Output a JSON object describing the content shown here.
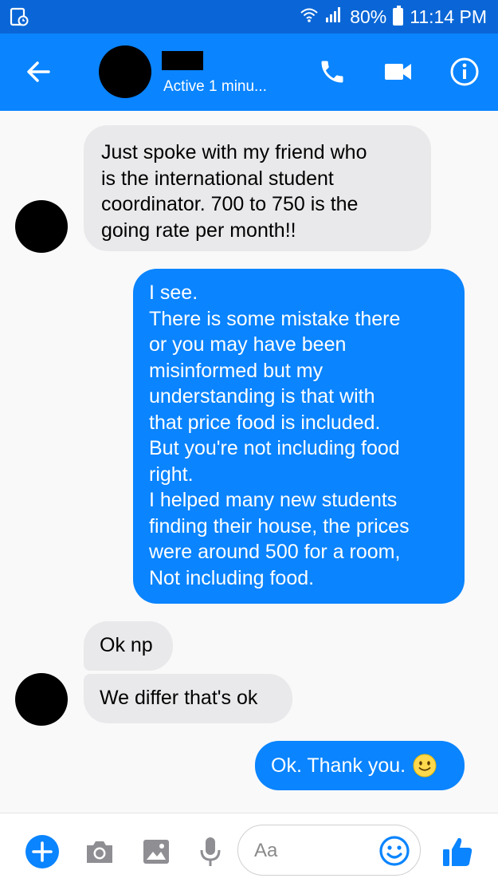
{
  "status_bar": {
    "battery": "80%",
    "time": "11:14 PM"
  },
  "header": {
    "active_status": "Active 1 minu..."
  },
  "messages": [
    {
      "direction": "incoming",
      "lines": [
        "Just spoke with my friend who",
        "is the international student",
        "coordinator. 700 to 750 is the",
        "going rate per month!!"
      ]
    },
    {
      "direction": "outgoing",
      "lines": [
        "I see.",
        "There is some mistake there",
        "or you may have been",
        "misinformed but my",
        "understanding is that with",
        "that price food is included.",
        "But you're not including food",
        "right.",
        "I helped many new students",
        "finding their house, the prices",
        "were around 500 for a room,",
        "Not including food."
      ]
    },
    {
      "direction": "incoming",
      "lines": [
        "Ok np"
      ]
    },
    {
      "direction": "incoming",
      "lines": [
        "We differ that's ok"
      ]
    },
    {
      "direction": "outgoing",
      "lines": [
        "Ok. Thank you."
      ],
      "emoji": "slightly-smiling-face"
    }
  ],
  "composer": {
    "placeholder": "Aa"
  },
  "colors": {
    "status_bar": "#0a66d6",
    "header": "#0a84ff",
    "outgoing_bubble": "#0a84ff",
    "incoming_bubble": "#e9e9eb"
  }
}
